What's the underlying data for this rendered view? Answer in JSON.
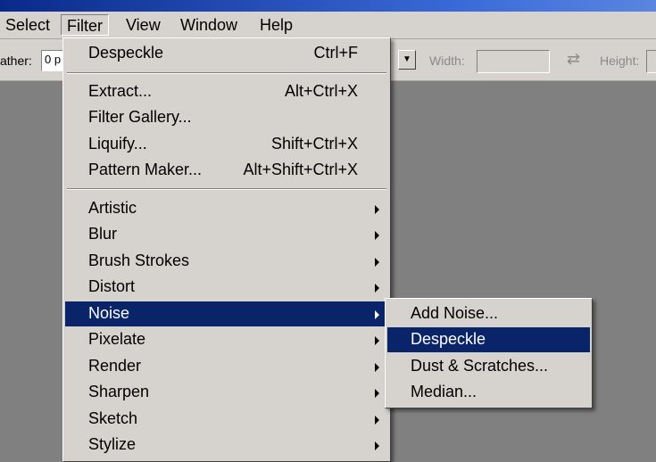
{
  "menubar": {
    "items": [
      "Select",
      "Filter",
      "View",
      "Window",
      "Help"
    ]
  },
  "options_bar": {
    "feather_label": "ather:",
    "feather_value": "0 p",
    "width_label": "Width:",
    "height_label": "Height:"
  },
  "filter_menu": {
    "last_filter": {
      "label": "Despeckle",
      "shortcut": "Ctrl+F"
    },
    "group1": [
      {
        "label": "Extract...",
        "shortcut": "Alt+Ctrl+X"
      },
      {
        "label": "Filter Gallery...",
        "shortcut": ""
      },
      {
        "label": "Liquify...",
        "shortcut": "Shift+Ctrl+X"
      },
      {
        "label": "Pattern Maker...",
        "shortcut": "Alt+Shift+Ctrl+X"
      }
    ],
    "submenus": [
      "Artistic",
      "Blur",
      "Brush Strokes",
      "Distort",
      "Noise",
      "Pixelate",
      "Render",
      "Sharpen",
      "Sketch",
      "Stylize"
    ],
    "highlighted": "Noise"
  },
  "noise_submenu": {
    "items": [
      "Add Noise...",
      "Despeckle",
      "Dust & Scratches...",
      "Median..."
    ],
    "highlighted": "Despeckle"
  },
  "colors": {
    "menu_bg": "#d6d3ce",
    "highlight": "#0a246a",
    "workspace": "#808080"
  }
}
